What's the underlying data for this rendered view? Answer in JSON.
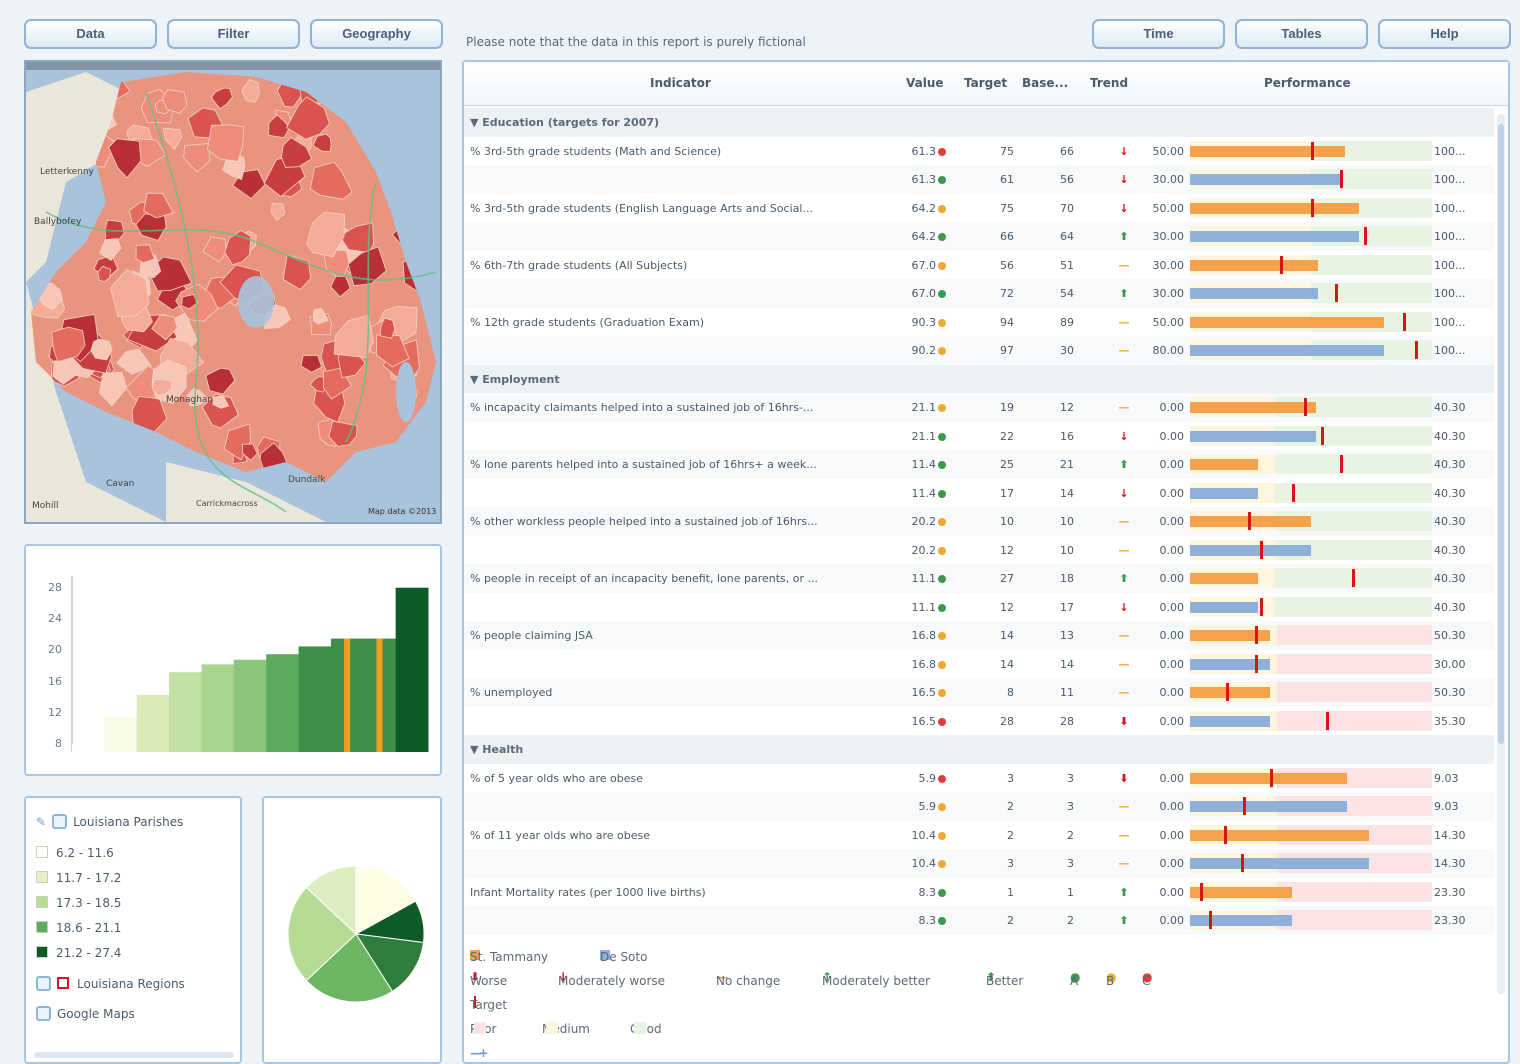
{
  "toolbar": {
    "left": [
      "Data",
      "Filter",
      "Geography"
    ],
    "right": [
      "Time",
      "Tables",
      "Help"
    ]
  },
  "note": "Please note that the data in this report is purely fictional",
  "map": {
    "labels": [
      "Letterkenny",
      "Ballybofey",
      "Monaghan",
      "Dundalk",
      "Cavan",
      "Carrickmacross",
      "Mohill"
    ],
    "credit": "Map data ©2013"
  },
  "table": {
    "headers": {
      "indicator": "Indicator",
      "value": "Value",
      "target": "Target",
      "base": "Base...",
      "trend": "Trend",
      "performance": "Performance"
    },
    "rows": [
      {
        "type": "group",
        "label": "▼ Education (targets for 2007)"
      },
      {
        "ind": "% 3rd-5th grade students (Math and Science)",
        "value": "61.3",
        "dot": "#e23b3b",
        "target": "75",
        "base": "66",
        "trend": "↓",
        "min": "50.00",
        "max": "100...",
        "bar": 0.64,
        "tick": 0.5,
        "color": "#f5a24d",
        "zones": [
          0.5,
          1.0
        ]
      },
      {
        "ind": "",
        "value": "61.3",
        "dot": "#3a9a4a",
        "target": "61",
        "base": "56",
        "trend": "↓",
        "min": "30.00",
        "max": "100...",
        "bar": 0.63,
        "tick": 0.62,
        "color": "#8fb0d8",
        "zones": [
          0.5,
          1.0
        ]
      },
      {
        "ind": "% 3rd-5th grade students (English Language Arts and Social...",
        "value": "64.2",
        "dot": "#f0a830",
        "target": "75",
        "base": "70",
        "trend": "↓",
        "min": "50.00",
        "max": "100...",
        "bar": 0.7,
        "tick": 0.5,
        "color": "#f5a24d",
        "zones": [
          0.5,
          1.0
        ]
      },
      {
        "ind": "",
        "value": "64.2",
        "dot": "#3a9a4a",
        "target": "66",
        "base": "64",
        "trend": "⬆",
        "min": "30.00",
        "max": "100...",
        "bar": 0.7,
        "tick": 0.72,
        "color": "#8fb0d8",
        "zones": [
          0.5,
          1.0
        ]
      },
      {
        "ind": "% 6th-7th grade students (All Subjects)",
        "value": "67.0",
        "dot": "#f0a830",
        "target": "56",
        "base": "51",
        "trend": "—",
        "min": "30.00",
        "max": "100...",
        "bar": 0.53,
        "tick": 0.37,
        "color": "#f5a24d",
        "zones": [
          0.5,
          1.0
        ]
      },
      {
        "ind": "",
        "value": "67.0",
        "dot": "#3a9a4a",
        "target": "72",
        "base": "54",
        "trend": "⬆",
        "min": "30.00",
        "max": "100...",
        "bar": 0.53,
        "tick": 0.6,
        "color": "#8fb0d8",
        "zones": [
          0.5,
          1.0
        ]
      },
      {
        "ind": "% 12th grade students (Graduation Exam)",
        "value": "90.3",
        "dot": "#f0a830",
        "target": "94",
        "base": "89",
        "trend": "—",
        "min": "50.00",
        "max": "100...",
        "bar": 0.8,
        "tick": 0.88,
        "color": "#f5a24d",
        "zones": [
          0.5,
          1.0
        ]
      },
      {
        "ind": "",
        "value": "90.2",
        "dot": "#f0a830",
        "target": "97",
        "base": "30",
        "trend": "—",
        "min": "80.00",
        "max": "100...",
        "bar": 0.8,
        "tick": 0.93,
        "color": "#8fb0d8",
        "zones": [
          0.5,
          1.0
        ]
      },
      {
        "type": "group",
        "label": "▼ Employment"
      },
      {
        "ind": "% incapacity claimants helped into a sustained job of 16hrs-...",
        "value": "21.1",
        "dot": "#f0a830",
        "target": "19",
        "base": "12",
        "trend": "—",
        "min": "0.00",
        "max": "40.30",
        "bar": 0.52,
        "tick": 0.47,
        "color": "#f5a24d",
        "zones": [
          0.35,
          1.0
        ]
      },
      {
        "ind": "",
        "value": "21.1",
        "dot": "#3a9a4a",
        "target": "22",
        "base": "16",
        "trend": "↓",
        "min": "0.00",
        "max": "40.30",
        "bar": 0.52,
        "tick": 0.54,
        "color": "#8fb0d8",
        "zones": [
          0.35,
          1.0
        ]
      },
      {
        "ind": "% lone parents helped into a sustained job of 16hrs+ a week...",
        "value": "11.4",
        "dot": "#3a9a4a",
        "target": "25",
        "base": "21",
        "trend": "⬆",
        "min": "0.00",
        "max": "40.30",
        "bar": 0.28,
        "tick": 0.62,
        "color": "#f5a24d",
        "zones": [
          0.35,
          1.0
        ]
      },
      {
        "ind": "",
        "value": "11.4",
        "dot": "#3a9a4a",
        "target": "17",
        "base": "14",
        "trend": "↓",
        "min": "0.00",
        "max": "40.30",
        "bar": 0.28,
        "tick": 0.42,
        "color": "#8fb0d8",
        "zones": [
          0.35,
          1.0
        ]
      },
      {
        "ind": "% other workless people helped into a sustained job of 16hrs...",
        "value": "20.2",
        "dot": "#f0a830",
        "target": "10",
        "base": "10",
        "trend": "—",
        "min": "0.00",
        "max": "40.30",
        "bar": 0.5,
        "tick": 0.24,
        "color": "#f5a24d",
        "zones": [
          0.35,
          1.0
        ]
      },
      {
        "ind": "",
        "value": "20.2",
        "dot": "#f0a830",
        "target": "12",
        "base": "10",
        "trend": "—",
        "min": "0.00",
        "max": "40.30",
        "bar": 0.5,
        "tick": 0.29,
        "color": "#8fb0d8",
        "zones": [
          0.35,
          1.0
        ]
      },
      {
        "ind": "% people in receipt of an incapacity benefit, lone parents, or ...",
        "value": "11.1",
        "dot": "#3a9a4a",
        "target": "27",
        "base": "18",
        "trend": "⬆",
        "min": "0.00",
        "max": "40.30",
        "bar": 0.28,
        "tick": 0.67,
        "color": "#f5a24d",
        "zones": [
          0.35,
          1.0
        ]
      },
      {
        "ind": "",
        "value": "11.1",
        "dot": "#3a9a4a",
        "target": "12",
        "base": "17",
        "trend": "↓",
        "min": "0.00",
        "max": "40.30",
        "bar": 0.28,
        "tick": 0.29,
        "color": "#8fb0d8",
        "zones": [
          0.35,
          1.0
        ]
      },
      {
        "ind": "% people claiming JSA",
        "value": "16.8",
        "dot": "#f0a830",
        "target": "14",
        "base": "13",
        "trend": "—",
        "min": "0.00",
        "max": "50.30",
        "bar": 0.33,
        "tick": 0.27,
        "color": "#f5a24d",
        "zones": [
          0.36,
          1.0
        ],
        "bad": true
      },
      {
        "ind": "",
        "value": "16.8",
        "dot": "#f0a830",
        "target": "14",
        "base": "14",
        "trend": "—",
        "min": "0.00",
        "max": "30.00",
        "bar": 0.33,
        "tick": 0.27,
        "color": "#8fb0d8",
        "zones": [
          0.36,
          1.0
        ],
        "bad": true
      },
      {
        "ind": "% unemployed",
        "value": "16.5",
        "dot": "#f0a830",
        "target": "8",
        "base": "11",
        "trend": "—",
        "min": "0.00",
        "max": "50.30",
        "bar": 0.33,
        "tick": 0.15,
        "color": "#f5a24d",
        "zones": [
          0.36,
          1.0
        ],
        "bad": true
      },
      {
        "ind": "",
        "value": "16.5",
        "dot": "#e23b3b",
        "target": "28",
        "base": "28",
        "trend": "⬇",
        "min": "0.00",
        "max": "35.30",
        "bar": 0.33,
        "tick": 0.56,
        "color": "#8fb0d8",
        "zones": [
          0.36,
          1.0
        ],
        "bad": true
      },
      {
        "type": "group",
        "label": "▼ Health"
      },
      {
        "ind": "% of 5 year olds who are obese",
        "value": "5.9",
        "dot": "#e23b3b",
        "target": "3",
        "base": "3",
        "trend": "⬇",
        "min": "0.00",
        "max": "9.03",
        "bar": 0.65,
        "tick": 0.33,
        "color": "#f5a24d",
        "zones": [
          0.36,
          1.0
        ],
        "bad": true
      },
      {
        "ind": "",
        "value": "5.9",
        "dot": "#f0a830",
        "target": "2",
        "base": "3",
        "trend": "—",
        "min": "0.00",
        "max": "9.03",
        "bar": 0.65,
        "tick": 0.22,
        "color": "#8fb0d8",
        "zones": [
          0.36,
          1.0
        ],
        "bad": true
      },
      {
        "ind": "% of 11 year olds who are obese",
        "value": "10.4",
        "dot": "#f0a830",
        "target": "2",
        "base": "2",
        "trend": "—",
        "min": "0.00",
        "max": "14.30",
        "bar": 0.74,
        "tick": 0.14,
        "color": "#f5a24d",
        "zones": [
          0.36,
          1.0
        ],
        "bad": true
      },
      {
        "ind": "",
        "value": "10.4",
        "dot": "#f0a830",
        "target": "3",
        "base": "3",
        "trend": "—",
        "min": "0.00",
        "max": "14.30",
        "bar": 0.74,
        "tick": 0.21,
        "color": "#8fb0d8",
        "zones": [
          0.36,
          1.0
        ],
        "bad": true
      },
      {
        "ind": "Infant Mortality rates (per 1000 live births)",
        "value": "8.3",
        "dot": "#3a9a4a",
        "target": "1",
        "base": "1",
        "trend": "⬆",
        "min": "0.00",
        "max": "23.30",
        "bar": 0.42,
        "tick": 0.04,
        "color": "#f5a24d",
        "zones": [
          0.36,
          1.0
        ],
        "bad": true
      },
      {
        "ind": "",
        "value": "8.3",
        "dot": "#3a9a4a",
        "target": "2",
        "base": "2",
        "trend": "⬆",
        "min": "0.00",
        "max": "23.30",
        "bar": 0.42,
        "tick": 0.08,
        "color": "#8fb0d8",
        "zones": [
          0.36,
          1.0
        ],
        "bad": true
      }
    ]
  },
  "legend_bottom": {
    "series": [
      "St. Tammany",
      "De Soto"
    ],
    "trend_title": "Worse",
    "trend_items": [
      "Moderately worse",
      "No change",
      "Moderately better",
      "Better"
    ],
    "status_items": [
      "A",
      "B",
      "C"
    ],
    "target_label": "Target",
    "zones": [
      "Poor",
      "Medium",
      "Good"
    ],
    "zoom": [
      "—",
      "+"
    ]
  },
  "bar_chart": {
    "type": "bar",
    "y_ticks": [
      "28",
      "24",
      "20",
      "16",
      "12",
      "8"
    ],
    "ylim": [
      7,
      29.5
    ],
    "values": [
      8,
      11.5,
      14.3,
      17.2,
      18.2,
      18.8,
      19.5,
      20.5,
      21.5,
      21.5,
      28
    ],
    "colors": [
      "#ffffff",
      "#f7fbe6",
      "#d9ecb8",
      "#c2e0a4",
      "#a9d48e",
      "#8cc67b",
      "#5daa5e",
      "#3f8f49",
      "#3f8f49",
      "#3f8f49",
      "#0d5a27"
    ],
    "highlight_indices": [
      8,
      9
    ]
  },
  "layers": {
    "title": "Louisiana Parishes",
    "ranges": [
      "6.2 - 11.6",
      "11.7 - 17.2",
      "17.3 - 18.5",
      "18.6 - 21.1",
      "21.2 - 27.4"
    ],
    "range_colors": [
      "#ffffff",
      "#e4efcc",
      "#b6db94",
      "#5fab5e",
      "#0e5a28"
    ],
    "regions": "Louisiana Regions",
    "google": "Google Maps"
  },
  "pie": {
    "type": "pie",
    "values": [
      17,
      10,
      14,
      22,
      24,
      13
    ],
    "colors": [
      "#fdfde6",
      "#0e5a28",
      "#2f7d3c",
      "#6cb563",
      "#b6db94",
      "#dcedc1"
    ]
  }
}
